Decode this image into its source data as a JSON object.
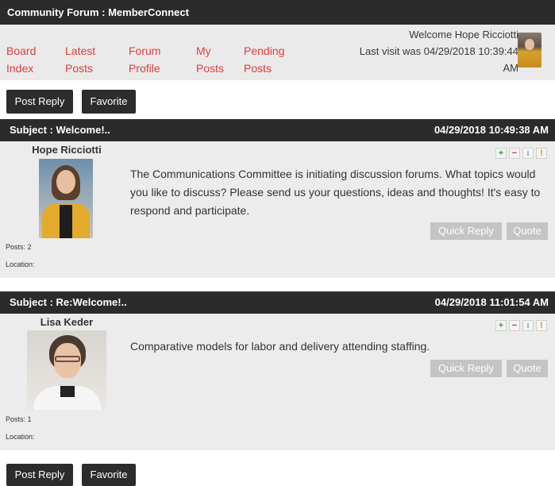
{
  "title": "Community Forum : MemberConnect",
  "nav": {
    "links": [
      {
        "line1": "Board",
        "line2": "Index"
      },
      {
        "line1": "Latest",
        "line2": "Posts"
      },
      {
        "line1": "Forum",
        "line2": "Profile"
      },
      {
        "line1": "My",
        "line2": "Posts"
      },
      {
        "line1": "Pending",
        "line2": "Posts"
      }
    ],
    "welcome": "Welcome Hope Ricciotti",
    "last_visit": "Last visit was 04/29/2018 10:39:44",
    "last_visit_suffix": "AM"
  },
  "buttons": {
    "post_reply": "Post Reply",
    "favorite": "Favorite",
    "quick_reply": "Quick Reply",
    "quote": "Quote"
  },
  "posts": [
    {
      "subject": "Subject : Welcome!..",
      "date": "04/29/2018 10:49:38 AM",
      "author": "Hope Ricciotti",
      "posts_label": "Posts: 2",
      "location_label": "Location:",
      "text": "The Communications Committee is initiating discussion forums. What topics would you like to discuss? Please send us your questions, ideas and thoughts! It's easy to respond and participate."
    },
    {
      "subject": "Subject : Re:Welcome!..",
      "date": "04/29/2018 11:01:54 AM",
      "author": "Lisa Keder",
      "posts_label": "Posts: 1",
      "location_label": "Location:",
      "text": "Comparative models for labor and delivery attending staffing."
    }
  ],
  "action_icons": [
    "plus-icon",
    "minus-icon",
    "info-icon",
    "flag-icon"
  ],
  "colors": {
    "link": "#e23b3b",
    "header": "#2b2b2b",
    "panel": "#ececec"
  }
}
